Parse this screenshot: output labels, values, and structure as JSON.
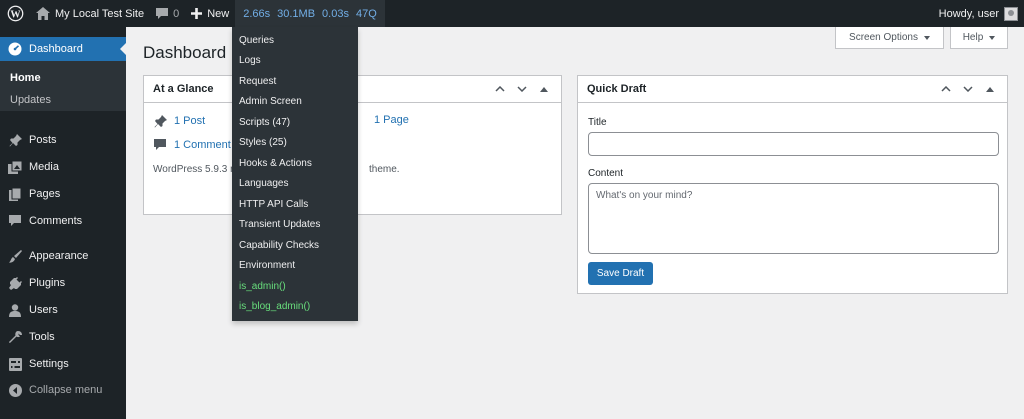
{
  "adminbar": {
    "site_name": "My Local Test Site",
    "comments_count": "0",
    "new_label": "New",
    "qm": {
      "time": "2.66s",
      "memory": "30.1MB",
      "db_time": "0.03s",
      "queries": "47Q"
    },
    "greeting": "Howdy, user"
  },
  "sidebar": {
    "dashboard": "Dashboard",
    "sub_home": "Home",
    "sub_updates": "Updates",
    "items": [
      "Posts",
      "Media",
      "Pages",
      "Comments",
      "Appearance",
      "Plugins",
      "Users",
      "Tools",
      "Settings",
      "Collapse menu"
    ]
  },
  "page": {
    "title": "Dashboard",
    "screen_options": "Screen Options",
    "help": "Help"
  },
  "at_a_glance": {
    "title": "At a Glance",
    "posts": "1 Post",
    "pages": "1 Page",
    "comments": "1 Comment",
    "version_text": "WordPress 5.9.3 r",
    "theme_text": "theme."
  },
  "quick_draft": {
    "title": "Quick Draft",
    "title_label": "Title",
    "content_label": "Content",
    "content_placeholder": "What's on your mind?",
    "save_button": "Save Draft"
  },
  "qm_menu": [
    "Queries",
    "Logs",
    "Request",
    "Admin Screen",
    "Scripts (47)",
    "Styles (25)",
    "Hooks & Actions",
    "Languages",
    "HTTP API Calls",
    "Transient Updates",
    "Capability Checks",
    "Environment",
    "is_admin()",
    "is_blog_admin()"
  ],
  "colors": {
    "adminbar": "#1d2327",
    "accent": "#2271b1",
    "qm_text": "#72aee6",
    "qm_green": "#68de7c",
    "background": "#f0f0f1"
  }
}
